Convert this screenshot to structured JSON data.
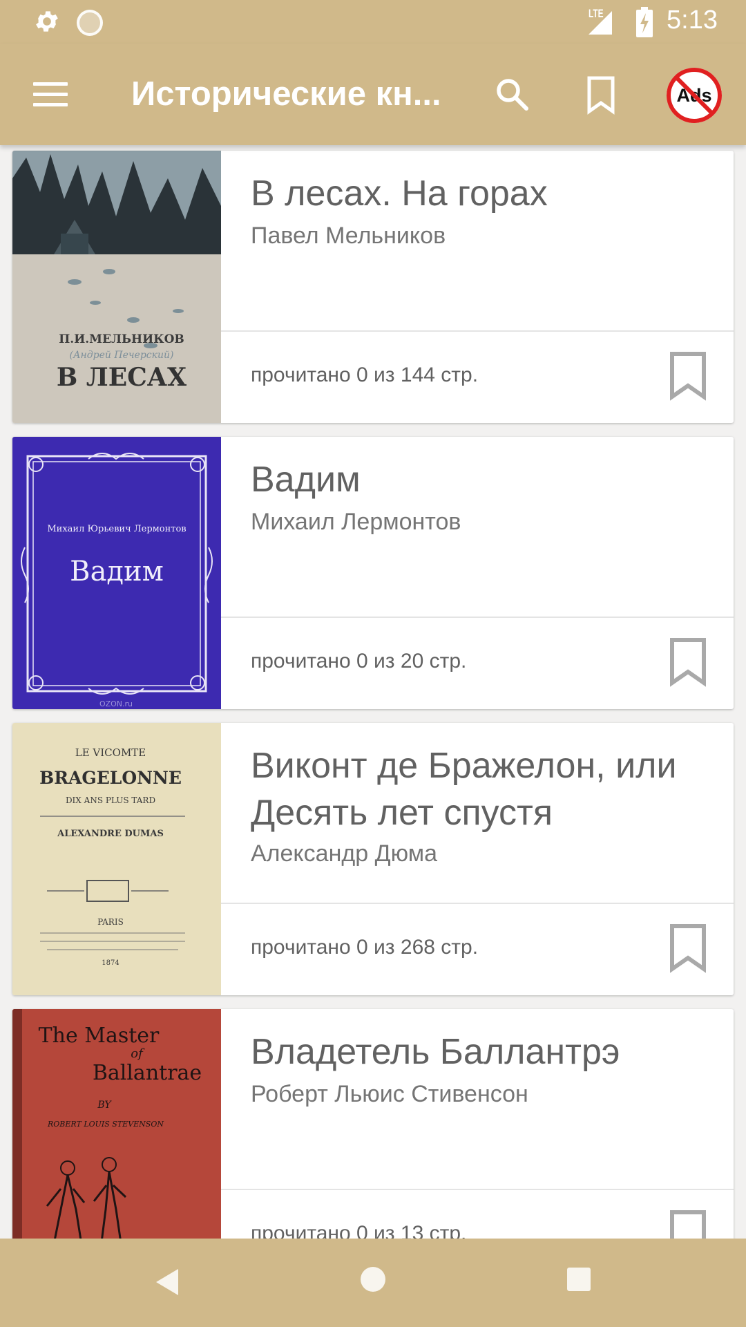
{
  "status_bar": {
    "time": "5:13",
    "network": "LTE"
  },
  "app_bar": {
    "title": "Исторические кн...",
    "icons": [
      "menu-icon",
      "search-icon",
      "bookmark-icon",
      "no-ads-icon"
    ],
    "no_ads_label": "Ads"
  },
  "books": [
    {
      "title": "В лесах. На горах",
      "author": "Павел Мельников",
      "progress": "прочитано 0 из 144 стр.",
      "cover": {
        "line1": "П.И.МЕЛЬНИКОВ",
        "line2": "(Андрей Печерский)",
        "line3": "В ЛЕСАХ"
      }
    },
    {
      "title": "Вадим",
      "author": "Михаил Лермонтов",
      "progress": "прочитано 0 из 20 стр.",
      "cover": {
        "line1": "Михаил Юрьевич Лермонтов",
        "line2": "Вадим",
        "line3": "OZON.ru"
      }
    },
    {
      "title": "Виконт де Бражелон, или Десять лет спустя",
      "author": "Александр Дюма",
      "progress": "прочитано 0 из 268 стр.",
      "cover": {
        "line1": "LE VICOMTE",
        "line2": "BRAGELONNE",
        "line3": "DIX ANS PLUS TARD",
        "line4": "ALEXANDRE DUMAS",
        "line5": "PARIS",
        "line6": "1874"
      }
    },
    {
      "title": "Владетель Баллантрэ",
      "author": "Роберт Льюис Стивенсон",
      "progress": "прочитано 0 из 13 стр.",
      "cover": {
        "line1": "The Master",
        "line2": "of",
        "line3": "Ballantrae",
        "line4": "BY",
        "line5": "ROBERT LOUIS STEVENSON"
      }
    }
  ],
  "colors": {
    "bar": "#d0b98a",
    "card": "#ffffff",
    "text": "#616161"
  }
}
